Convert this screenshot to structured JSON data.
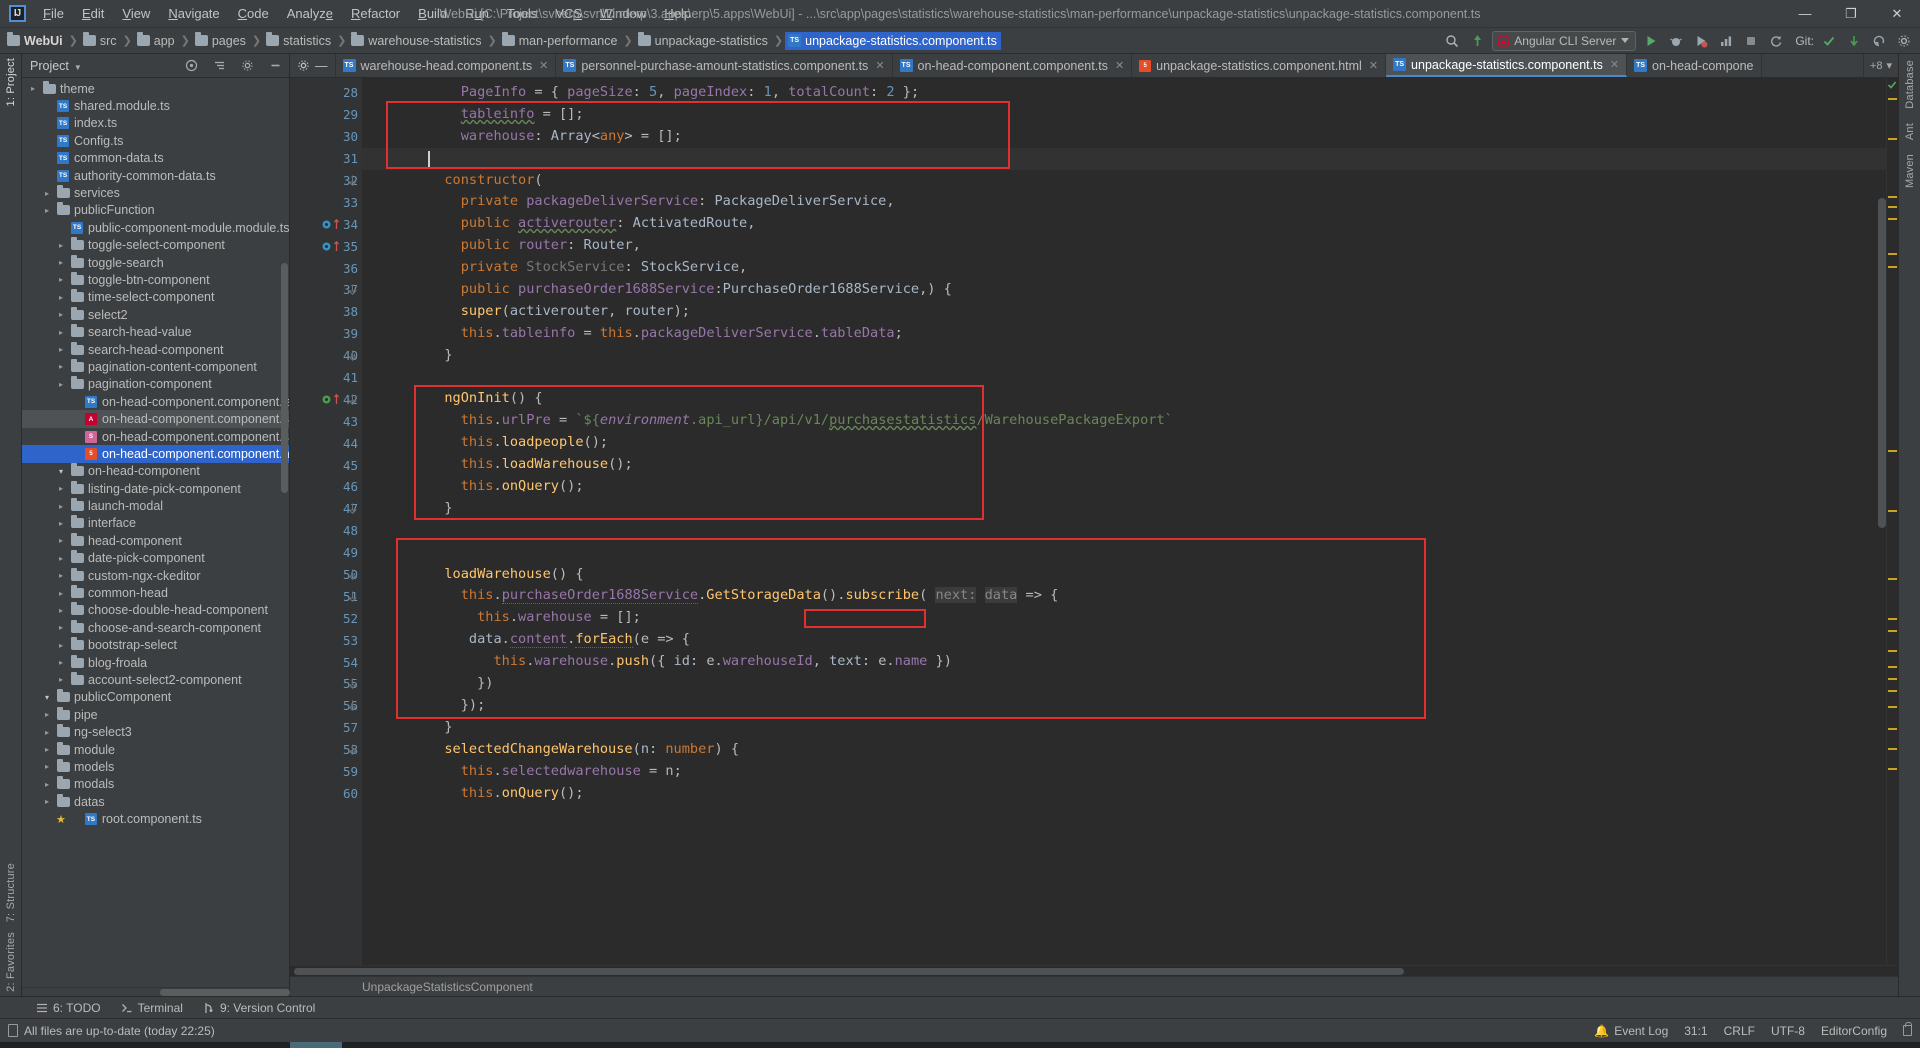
{
  "titlebar": {
    "logo": "IJ",
    "menu": [
      "File",
      "Edit",
      "View",
      "Navigate",
      "Code",
      "Analyze",
      "Refactor",
      "Build",
      "Run",
      "Tools",
      "VCS",
      "Window",
      "Help"
    ],
    "window_title": "WebUi [C:\\Project\\svnerp\\svn\\Dmterp\\3.apps\\erp\\5.apps\\WebUi] - ...\\src\\app\\pages\\statistics\\warehouse-statistics\\man-performance\\unpackage-statistics\\unpackage-statistics.component.ts",
    "minimize": "—",
    "maximize": "❐",
    "close": "✕"
  },
  "navbar": {
    "breadcrumbs": [
      {
        "label": "WebUi",
        "icon": "folder-icon",
        "active": false,
        "root": true
      },
      {
        "label": "src",
        "icon": "folder-icon",
        "active": false
      },
      {
        "label": "app",
        "icon": "folder-icon",
        "active": false
      },
      {
        "label": "pages",
        "icon": "folder-icon",
        "active": false
      },
      {
        "label": "statistics",
        "icon": "folder-icon",
        "active": false
      },
      {
        "label": "warehouse-statistics",
        "icon": "folder-icon",
        "active": false
      },
      {
        "label": "man-performance",
        "icon": "folder-icon",
        "active": false
      },
      {
        "label": "unpackage-statistics",
        "icon": "folder-icon",
        "active": false
      },
      {
        "label": "unpackage-statistics.component.ts",
        "icon": "typescript-file-icon",
        "active": true
      }
    ],
    "run_config": "Angular CLI Server",
    "git_label": "Git:",
    "run_icon": "run-icon",
    "debug_icon": "debug-icon",
    "stop_icon": "stop-icon",
    "coverage_icon": "coverage-icon",
    "profile_icon": "profile-icon",
    "search_icon": "search-icon",
    "update_icon": "update-project-icon",
    "commit_icon": "commit-icon",
    "rollback_icon": "rollback-icon"
  },
  "rails": {
    "left_top": [
      "1: Project"
    ],
    "left_bottom": [
      "7: Structure",
      "2: Favorites"
    ],
    "right": [
      "Database",
      "Ant",
      "Maven"
    ]
  },
  "project": {
    "title": "Project",
    "settings_icon": "gear-icon",
    "collapse_icon": "collapse-all-icon",
    "hide_icon": "hide-icon",
    "tree": [
      {
        "indent": 2,
        "arrow": "",
        "icon": "ts-file",
        "label": "root.component.ts"
      },
      {
        "indent": 1,
        "arrow": "▸",
        "icon": "folder",
        "label": "datas"
      },
      {
        "indent": 1,
        "arrow": "▸",
        "icon": "folder",
        "label": "modals"
      },
      {
        "indent": 1,
        "arrow": "▸",
        "icon": "folder",
        "label": "models"
      },
      {
        "indent": 1,
        "arrow": "▸",
        "icon": "folder",
        "label": "module"
      },
      {
        "indent": 1,
        "arrow": "▸",
        "icon": "folder",
        "label": "ng-select3"
      },
      {
        "indent": 1,
        "arrow": "▸",
        "icon": "folder",
        "label": "pipe"
      },
      {
        "indent": 1,
        "arrow": "▾",
        "icon": "folder",
        "label": "publicComponent"
      },
      {
        "indent": 2,
        "arrow": "▸",
        "icon": "folder",
        "label": "account-select2-component"
      },
      {
        "indent": 2,
        "arrow": "▸",
        "icon": "folder",
        "label": "blog-froala"
      },
      {
        "indent": 2,
        "arrow": "▸",
        "icon": "folder",
        "label": "bootstrap-select"
      },
      {
        "indent": 2,
        "arrow": "▸",
        "icon": "folder",
        "label": "choose-and-search-component"
      },
      {
        "indent": 2,
        "arrow": "▸",
        "icon": "folder",
        "label": "choose-double-head-component"
      },
      {
        "indent": 2,
        "arrow": "▸",
        "icon": "folder",
        "label": "common-head"
      },
      {
        "indent": 2,
        "arrow": "▸",
        "icon": "folder",
        "label": "custom-ngx-ckeditor"
      },
      {
        "indent": 2,
        "arrow": "▸",
        "icon": "folder",
        "label": "date-pick-component"
      },
      {
        "indent": 2,
        "arrow": "▸",
        "icon": "folder",
        "label": "head-component"
      },
      {
        "indent": 2,
        "arrow": "▸",
        "icon": "folder",
        "label": "interface"
      },
      {
        "indent": 2,
        "arrow": "▸",
        "icon": "folder",
        "label": "launch-modal"
      },
      {
        "indent": 2,
        "arrow": "▸",
        "icon": "folder",
        "label": "listing-date-pick-component"
      },
      {
        "indent": 2,
        "arrow": "▾",
        "icon": "folder",
        "label": "on-head-component"
      },
      {
        "indent": 3,
        "arrow": "",
        "icon": "html-file",
        "label": "on-head-component.component.html",
        "selected": true
      },
      {
        "indent": 3,
        "arrow": "",
        "icon": "scss-file",
        "label": "on-head-component.component.scss"
      },
      {
        "indent": 3,
        "arrow": "",
        "icon": "ng-file",
        "label": "on-head-component.component.spec.ts",
        "highlight": true
      },
      {
        "indent": 3,
        "arrow": "",
        "icon": "ts-file",
        "label": "on-head-component.component.ts"
      },
      {
        "indent": 2,
        "arrow": "▸",
        "icon": "folder",
        "label": "pagination-component"
      },
      {
        "indent": 2,
        "arrow": "▸",
        "icon": "folder",
        "label": "pagination-content-component"
      },
      {
        "indent": 2,
        "arrow": "▸",
        "icon": "folder",
        "label": "search-head-component"
      },
      {
        "indent": 2,
        "arrow": "▸",
        "icon": "folder",
        "label": "search-head-value"
      },
      {
        "indent": 2,
        "arrow": "▸",
        "icon": "folder",
        "label": "select2"
      },
      {
        "indent": 2,
        "arrow": "▸",
        "icon": "folder",
        "label": "time-select-component"
      },
      {
        "indent": 2,
        "arrow": "▸",
        "icon": "folder",
        "label": "toggle-btn-component"
      },
      {
        "indent": 2,
        "arrow": "▸",
        "icon": "folder",
        "label": "toggle-search"
      },
      {
        "indent": 2,
        "arrow": "▸",
        "icon": "folder",
        "label": "toggle-select-component"
      },
      {
        "indent": 2,
        "arrow": "",
        "icon": "ts-file",
        "label": "public-component-module.module.ts"
      },
      {
        "indent": 1,
        "arrow": "▸",
        "icon": "folder",
        "label": "publicFunction"
      },
      {
        "indent": 1,
        "arrow": "▸",
        "icon": "folder",
        "label": "services"
      },
      {
        "indent": 1,
        "arrow": "",
        "icon": "ts-file",
        "label": "authority-common-data.ts"
      },
      {
        "indent": 1,
        "arrow": "",
        "icon": "ts-file",
        "label": "common-data.ts"
      },
      {
        "indent": 1,
        "arrow": "",
        "icon": "ts-file",
        "label": "Config.ts"
      },
      {
        "indent": 1,
        "arrow": "",
        "icon": "ts-file",
        "label": "index.ts"
      },
      {
        "indent": 1,
        "arrow": "",
        "icon": "ts-file",
        "label": "shared.module.ts"
      },
      {
        "indent": 0,
        "arrow": "▸",
        "icon": "folder",
        "label": "theme"
      }
    ]
  },
  "tabs": [
    {
      "label": "warehouse-head.component.ts",
      "icon": "typescript-file-icon",
      "active": false
    },
    {
      "label": "personnel-purchase-amount-statistics.component.ts",
      "icon": "typescript-file-icon",
      "active": false
    },
    {
      "label": "on-head-component.component.ts",
      "icon": "typescript-file-icon",
      "active": false
    },
    {
      "label": "unpackage-statistics.component.html",
      "icon": "html-file-icon",
      "active": false
    },
    {
      "label": "unpackage-statistics.component.ts",
      "icon": "typescript-file-icon",
      "active": true
    },
    {
      "label": "on-head-compone",
      "icon": "typescript-file-icon",
      "active": false
    }
  ],
  "tabs_overflow": "+8",
  "editor": {
    "first_line": 28,
    "lines": [
      {
        "n": 28,
        "text": "    PageInfo = { pageSize: 5, pageIndex: 1, totalCount: 2 };"
      },
      {
        "n": 29,
        "text": "    tableinfo = [];"
      },
      {
        "n": 30,
        "text": "    warehouse: Array<any> = [];"
      },
      {
        "n": 31,
        "text": "    "
      },
      {
        "n": 32,
        "text": "  constructor("
      },
      {
        "n": 33,
        "text": "    private packageDeliverService: PackageDeliverService,"
      },
      {
        "n": 34,
        "text": "    public activerouter: ActivatedRoute,"
      },
      {
        "n": 35,
        "text": "    public router: Router,"
      },
      {
        "n": 36,
        "text": "    private StockService: StockService,"
      },
      {
        "n": 37,
        "text": "    public purchaseOrder1688Service:PurchaseOrder1688Service,) {"
      },
      {
        "n": 38,
        "text": "    super(activerouter, router);"
      },
      {
        "n": 39,
        "text": "    this.tableinfo = this.packageDeliverService.tableData;"
      },
      {
        "n": 40,
        "text": "  }"
      },
      {
        "n": 41,
        "text": ""
      },
      {
        "n": 42,
        "text": "  ngOnInit() {"
      },
      {
        "n": 43,
        "text": "    this.urlPre = `${environment.api_url}/api/v1/purchasestatistics/WarehousePackageExport`"
      },
      {
        "n": 44,
        "text": "    this.loadpeople();"
      },
      {
        "n": 45,
        "text": "    this.loadWarehouse();"
      },
      {
        "n": 46,
        "text": "    this.onQuery();"
      },
      {
        "n": 47,
        "text": "  }"
      },
      {
        "n": 48,
        "text": ""
      },
      {
        "n": 49,
        "text": ""
      },
      {
        "n": 50,
        "text": "  loadWarehouse() {"
      },
      {
        "n": 51,
        "text": "    this.purchaseOrder1688Service.GetStorageData().subscribe( next: data => {"
      },
      {
        "n": 52,
        "text": "      this.warehouse = [];"
      },
      {
        "n": 53,
        "text": "     data.content.forEach(e => {"
      },
      {
        "n": 54,
        "text": "        this.warehouse.push({ id: e.warehouseId, text: e.name })"
      },
      {
        "n": 55,
        "text": "      })"
      },
      {
        "n": 56,
        "text": "    });"
      },
      {
        "n": 57,
        "text": "  }"
      },
      {
        "n": 58,
        "text": "  selectedChangeWarehouse(n: number) {"
      },
      {
        "n": 59,
        "text": "    this.selectedwarehouse = n;"
      },
      {
        "n": 60,
        "text": "    this.onQuery();"
      }
    ],
    "breadcrumb": "UnpackageStatisticsComponent"
  },
  "bottom_strip": [
    {
      "label": "6: TODO",
      "icon": "todo-icon"
    },
    {
      "label": "Terminal",
      "icon": "terminal-icon"
    },
    {
      "label": "9: Version Control",
      "icon": "vcs-icon"
    }
  ],
  "status": {
    "message": "All files are up-to-date (today 22:25)",
    "caret": "31:1",
    "line_sep": "CRLF",
    "encoding": "UTF-8",
    "config": "EditorConfig",
    "event_log": "Event Log",
    "lock_icon": "read-only-lock-icon"
  }
}
